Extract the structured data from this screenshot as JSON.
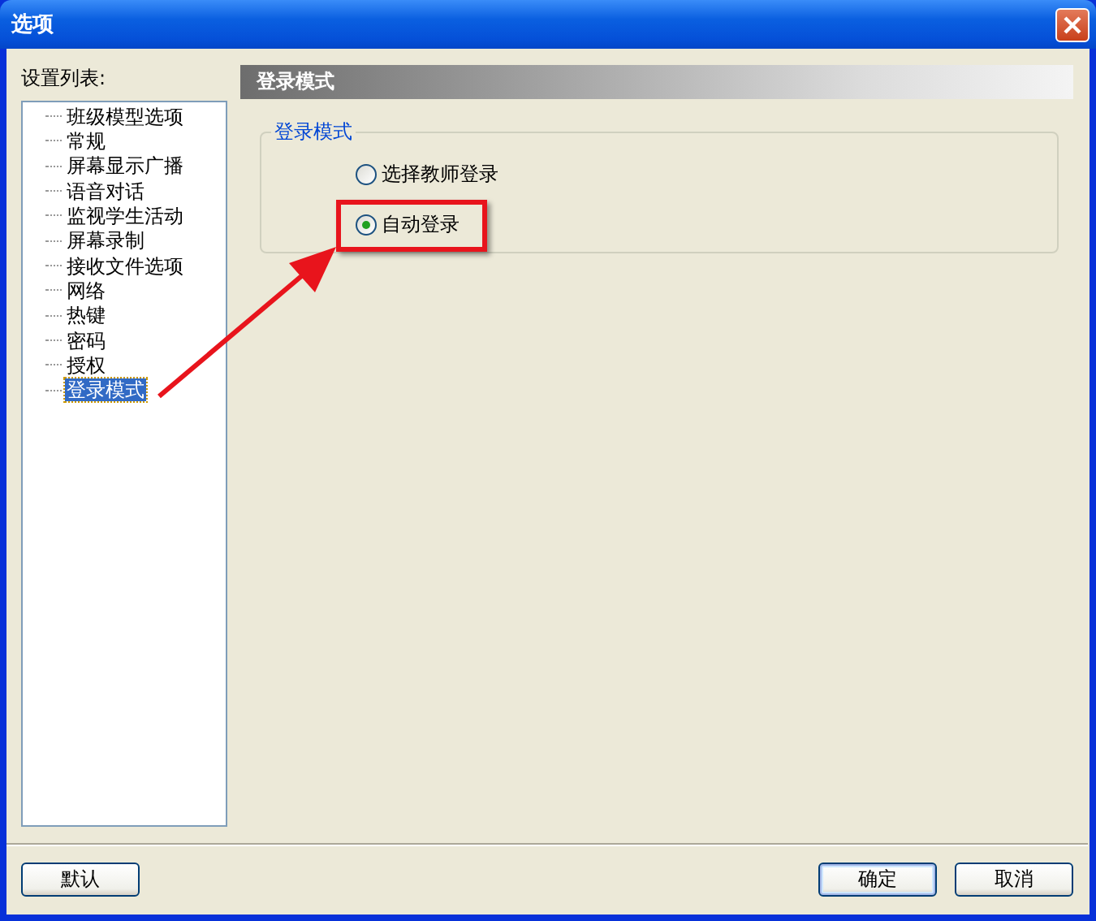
{
  "window": {
    "title": "选项"
  },
  "sidebar": {
    "label": "设置列表:",
    "items": [
      {
        "label": "班级模型选项",
        "selected": false
      },
      {
        "label": "常规",
        "selected": false
      },
      {
        "label": "屏幕显示广播",
        "selected": false
      },
      {
        "label": "语音对话",
        "selected": false
      },
      {
        "label": "监视学生活动",
        "selected": false
      },
      {
        "label": "屏幕录制",
        "selected": false
      },
      {
        "label": "接收文件选项",
        "selected": false
      },
      {
        "label": "网络",
        "selected": false
      },
      {
        "label": "热键",
        "selected": false
      },
      {
        "label": "密码",
        "selected": false
      },
      {
        "label": "授权",
        "selected": false
      },
      {
        "label": "登录模式",
        "selected": true
      }
    ]
  },
  "panel": {
    "header": "登录模式",
    "group": {
      "title": "登录模式",
      "options": [
        {
          "label": "选择教师登录",
          "selected": false
        },
        {
          "label": "自动登录",
          "selected": true
        }
      ]
    }
  },
  "buttons": [
    {
      "label": "默认",
      "default": false
    },
    {
      "label": "确定",
      "default": true
    },
    {
      "label": "取消",
      "default": false
    }
  ]
}
